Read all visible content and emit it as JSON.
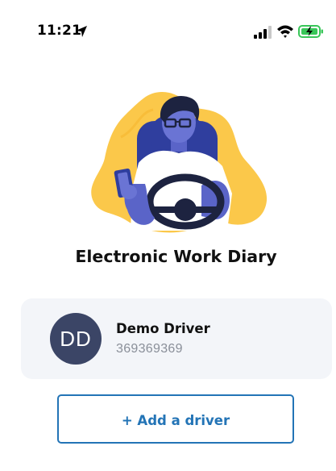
{
  "status_bar": {
    "time": "11:21",
    "icons": [
      "location-arrow-icon",
      "cellular-signal-icon",
      "wifi-icon",
      "battery-charging-icon"
    ],
    "battery_color": "#39c659"
  },
  "hero": {
    "icon": "driver-illustration",
    "colors": {
      "background_blob": "#fbc84a",
      "person_blue": "#5a64c8",
      "seat_dark": "#2f3e9e",
      "shirt": "#ffffff",
      "hair": "#1d2340"
    }
  },
  "app": {
    "title": "Electronic Work Diary"
  },
  "driver_card": {
    "initials": "DD",
    "name": "Demo Driver",
    "id_number": "369369369",
    "avatar_color": "#3b4566",
    "card_color": "#f3f5f9"
  },
  "actions": {
    "add_driver_label": "+ Add a driver",
    "accent_color": "#2374b6"
  }
}
